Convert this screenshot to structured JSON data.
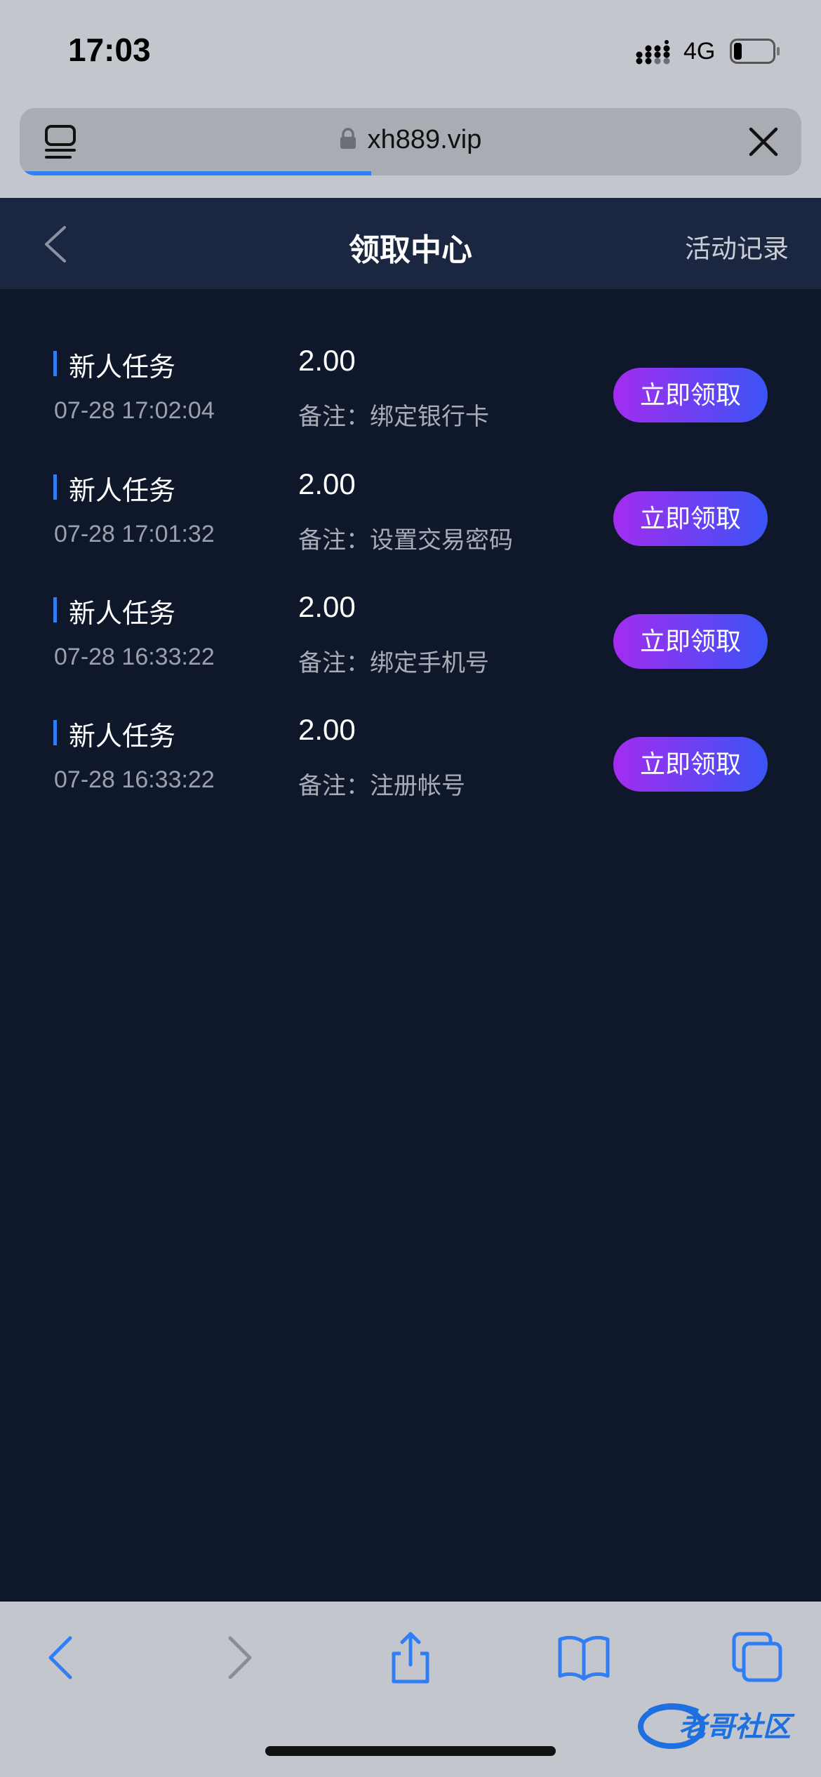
{
  "status_bar": {
    "time": "17:03",
    "network": "4G",
    "battery_level": 0.2
  },
  "browser": {
    "url": "xh889.vip",
    "load_progress": 0.45
  },
  "header": {
    "title": "领取中心",
    "records_link": "活动记录"
  },
  "tasks": [
    {
      "title": "新人任务",
      "time": "07-28 17:02:04",
      "amount": "2.00",
      "note": "备注：绑定银行卡",
      "button": "立即领取"
    },
    {
      "title": "新人任务",
      "time": "07-28 17:01:32",
      "amount": "2.00",
      "note": "备注：设置交易密码",
      "button": "立即领取"
    },
    {
      "title": "新人任务",
      "time": "07-28 16:33:22",
      "amount": "2.00",
      "note": "备注：绑定手机号",
      "button": "立即领取"
    },
    {
      "title": "新人任务",
      "time": "07-28 16:33:22",
      "amount": "2.00",
      "note": "备注：注册帐号",
      "button": "立即领取"
    }
  ],
  "colors": {
    "accent": "#2f7ef5",
    "button_start": "#a32cf0",
    "button_end": "#3b54f5",
    "background": "#0f172a",
    "header": "#1b2640"
  },
  "icons": [
    "reader-icon",
    "lock-icon",
    "close-icon",
    "back-icon",
    "forward-icon",
    "share-icon",
    "bookmarks-icon",
    "tabs-icon"
  ],
  "watermark": "老哥社区"
}
